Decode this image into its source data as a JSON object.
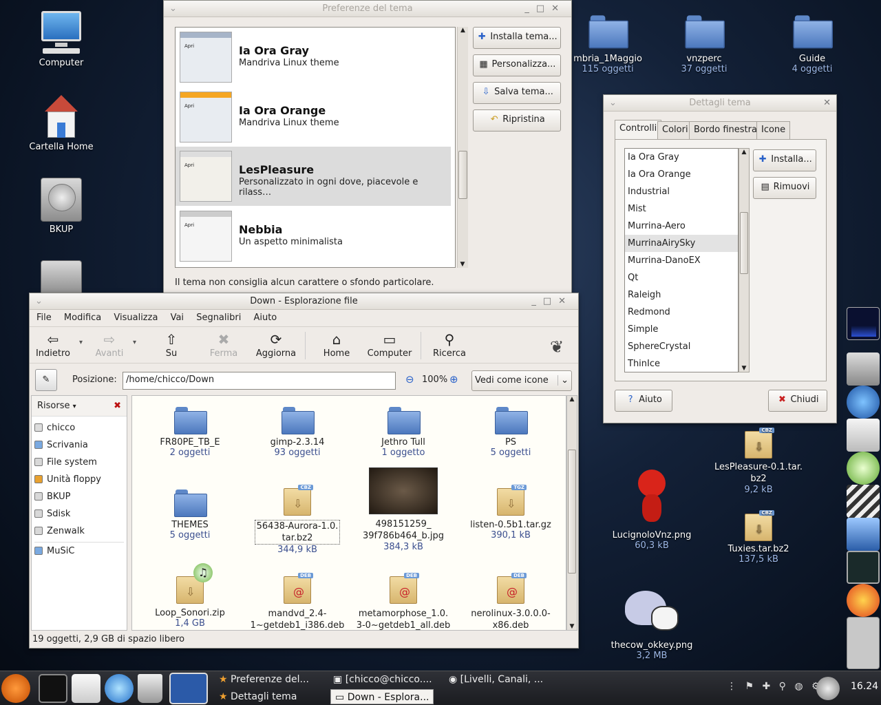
{
  "desktop": {
    "icons": [
      {
        "label": "Computer"
      },
      {
        "label": "Cartella Home"
      },
      {
        "label": "BKUP"
      },
      {
        "label": "mbria_1Maggio",
        "sub": "115 oggetti"
      },
      {
        "label": "vnzperc",
        "sub": "37 oggetti"
      },
      {
        "label": "Guide",
        "sub": "4 oggetti"
      },
      {
        "label": "LesPleasure-0.1.tar.\nbz2",
        "sub": "9,2 kB"
      },
      {
        "label": "Tuxies.tar.bz2",
        "sub": "137,5 kB"
      },
      {
        "label": "LucignoloVnz.png",
        "sub": "60,3 kB"
      },
      {
        "label": "thecow_okkey.png",
        "sub": "3,2 MB"
      }
    ]
  },
  "theme_prefs": {
    "title": "Preferenze del tema",
    "themes": [
      {
        "name": "Ia Ora Gray",
        "desc": "Mandriva Linux theme",
        "preview_label": "Apri"
      },
      {
        "name": "Ia Ora Orange",
        "desc": "Mandriva Linux theme",
        "preview_label": "Apri"
      },
      {
        "name": "LesPleasure",
        "desc": "Personalizzato in ogni dove, piacevole e rilass…",
        "preview_label": "Apri"
      },
      {
        "name": "Nebbia",
        "desc": "Un aspetto minimalista",
        "preview_label": "Apri"
      }
    ],
    "buttons": {
      "install": "Installa tema...",
      "customize": "Personalizza...",
      "save": "Salva tema...",
      "revert": "Ripristina"
    },
    "note": "Il tema non consiglia alcun carattere o sfondo particolare."
  },
  "theme_details": {
    "title": "Dettagli tema",
    "tabs": [
      "Controlli",
      "Colori",
      "Bordo finestra",
      "Icone"
    ],
    "items": [
      "Ia Ora Gray",
      "Ia Ora Orange",
      "Industrial",
      "Mist",
      "Murrina-Aero",
      "MurrinaAirySky",
      "Murrina-DanoEX",
      "Qt",
      "Raleigh",
      "Redmond",
      "Simple",
      "SphereCrystal",
      "ThinIce"
    ],
    "buttons": {
      "install": "Installa...",
      "remove": "Rimuovi",
      "help": "Aiuto",
      "close": "Chiudi"
    }
  },
  "file_browser": {
    "title": "Down - Esplorazione file",
    "menu": [
      "File",
      "Modifica",
      "Visualizza",
      "Vai",
      "Segnalibri",
      "Aiuto"
    ],
    "toolbar": {
      "back": "Indietro",
      "forward": "Avanti",
      "up": "Su",
      "stop": "Ferma",
      "reload": "Aggiorna",
      "home": "Home",
      "computer": "Computer",
      "search": "Ricerca"
    },
    "location_label": "Posizione:",
    "location": "/home/chicco/Down",
    "zoom": "100%",
    "view_mode": "Vedi come icone",
    "sidebar_title": "Risorse",
    "sidebar": [
      "chicco",
      "Scrivania",
      "File system",
      "Unità floppy",
      "BKUP",
      "Sdisk",
      "Zenwalk",
      "MuSiC"
    ],
    "files": [
      {
        "name": "FR80PE_TB_E",
        "sub": "2 oggetti"
      },
      {
        "name": "gimp-2.3.14",
        "sub": "93 oggetti"
      },
      {
        "name": "Jethro Tull",
        "sub": "1 oggetto"
      },
      {
        "name": "PS",
        "sub": "5 oggetti"
      },
      {
        "name": "THEMES",
        "sub": "5 oggetti"
      },
      {
        "name": "56438-Aurora-1.0.\ntar.bz2",
        "sub": "344,9 kB"
      },
      {
        "name": "498151259_\n39f786b464_b.jpg",
        "sub": "384,3 kB"
      },
      {
        "name": "listen-0.5b1.tar.gz",
        "sub": "390,1 kB"
      },
      {
        "name": "Loop_Sonori.zip",
        "sub": "1,4 GB"
      },
      {
        "name": "mandvd_2.4-\n1~getdeb1_i386.deb",
        "sub": ""
      },
      {
        "name": "metamorphose_1.0.\n3-0~getdeb1_all.deb",
        "sub": ""
      },
      {
        "name": "nerolinux-3.0.0.0-\nx86.deb",
        "sub": ""
      }
    ],
    "status": "19 oggetti, 2,9 GB di spazio libero"
  },
  "panel": {
    "tasks": [
      "Preferenze del...",
      "[chicco@chicco....",
      "[Livelli, Canali, ...",
      "Dettagli tema",
      "Down - Esplora..."
    ],
    "clock": "16.24"
  }
}
